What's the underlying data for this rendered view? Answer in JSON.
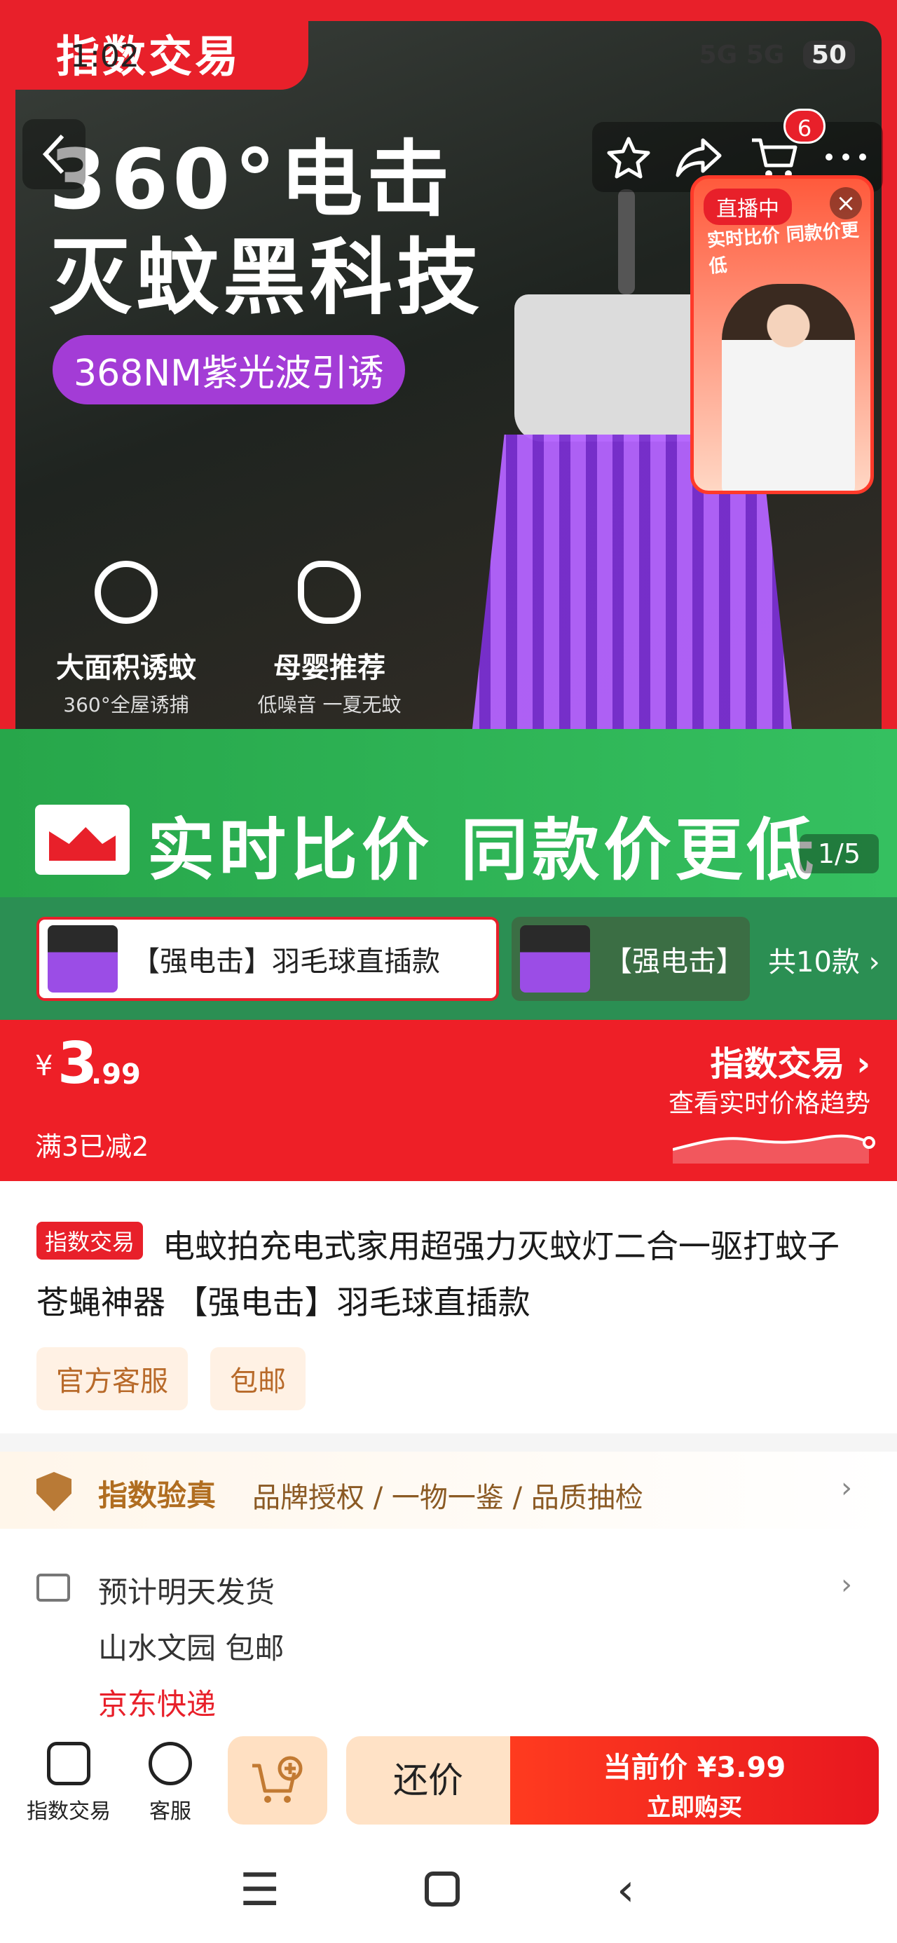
{
  "status_bar": {
    "time": "1:02",
    "signal_text": "5G 5G",
    "battery": "50"
  },
  "hero": {
    "brand_tab": "指数交易",
    "headline_line1": "360°电击",
    "headline_line2": "灭蚊黑科技",
    "pill_text": "368NM紫光波引诱",
    "features": [
      {
        "title": "大面积诱蚊",
        "subtitle": "360°全屋诱捕",
        "icon": "target-icon"
      },
      {
        "title": "母婴推荐",
        "subtitle": "低噪音 一夏无蚊",
        "icon": "leaf-icon"
      }
    ],
    "price_banner_text": "实时比价  同款价更低",
    "image_counter": "1/5"
  },
  "top_actions": {
    "back_icon": "chevron-left",
    "favorite_icon": "star",
    "share_icon": "share",
    "cart_icon": "cart",
    "cart_badge": "6",
    "more_icon": "more"
  },
  "live_popup": {
    "label": "直播中",
    "close": "×",
    "promo": "实时比价 同款价更低"
  },
  "variants": {
    "items": [
      {
        "label": "【强电击】羽毛球直插款",
        "selected": true
      },
      {
        "label": "【强电击】",
        "selected": false
      }
    ],
    "total": "共10款 ›"
  },
  "price": {
    "currency": "¥",
    "integer": "3",
    "decimal": ".99",
    "discount": "满3已减2",
    "brand": "指数交易 ›",
    "trend_text": "查看实时价格趋势"
  },
  "product": {
    "badge": "指数交易",
    "title": "电蚊拍充电式家用超强力灭蚊灯二合一驱打蚊子苍蝇神器 【强电击】羽毛球直插款",
    "tags": [
      "官方客服",
      "包邮"
    ]
  },
  "verify": {
    "title": "指数验真",
    "detail": "品牌授权 / 一物一鉴 / 品质抽检"
  },
  "delivery": {
    "line1": "预计明天发货",
    "line2": "山水文园 包邮",
    "line3": "京东快递"
  },
  "bottom_bar": {
    "home_label": "指数交易",
    "service_label": "客服",
    "bargain_label": "还价",
    "buy_price": "当前价 ¥3.99",
    "buy_label": "立即购买"
  },
  "colors": {
    "brand_red": "#e8202a",
    "banner_green": "#2fb356",
    "tag_bg": "#fff1e4",
    "verify_gold": "#b06d20"
  }
}
